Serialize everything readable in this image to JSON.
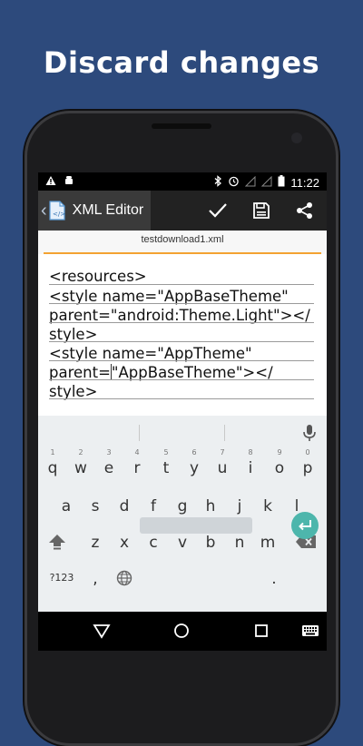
{
  "promo": {
    "title": "Discard changes"
  },
  "status_bar": {
    "time": "11:22"
  },
  "action_bar": {
    "back_icon": "chevron-left-icon",
    "app_icon": "document-icon",
    "title": "XML Editor",
    "actions": [
      "check-icon",
      "save-icon",
      "share-icon"
    ]
  },
  "file": {
    "name": "testdownload1.xml"
  },
  "editor": {
    "lines": [
      "<resources>",
      "  <style name=\"AppBaseTheme\"",
      "parent=\"android:Theme.Light\"></",
      "style>",
      "   <style name=\"AppTheme\"",
      "parent=",
      "\"AppBaseTheme\"></",
      "style>"
    ]
  },
  "keyboard": {
    "row1": [
      "q",
      "w",
      "e",
      "r",
      "t",
      "y",
      "u",
      "i",
      "o",
      "p"
    ],
    "row1_hints": [
      "1",
      "2",
      "3",
      "4",
      "5",
      "6",
      "7",
      "8",
      "9",
      "0"
    ],
    "row2": [
      "a",
      "s",
      "d",
      "f",
      "g",
      "h",
      "j",
      "k",
      "l"
    ],
    "row3": [
      "z",
      "x",
      "c",
      "v",
      "b",
      "n",
      "m"
    ],
    "symbols_key": "?123",
    "comma_key": ",",
    "period_key": ".",
    "accent_color": "#4db6ac"
  },
  "colors": {
    "background": "#2d4a7c",
    "accent_line": "#f3a232",
    "action_bar": "#222222"
  }
}
